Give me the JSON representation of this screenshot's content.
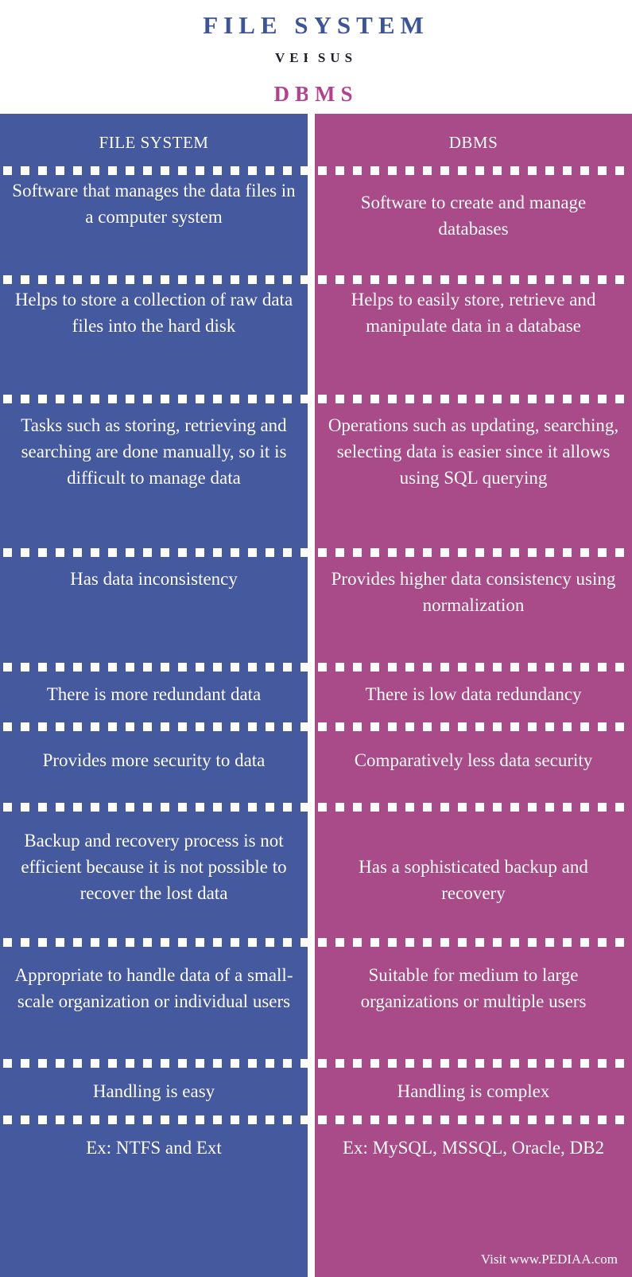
{
  "title": {
    "main": "FILE SYSTEM",
    "versus": "VERSUS",
    "sub": "DBMS"
  },
  "colors": {
    "left_panel": "#45599f",
    "right_panel": "#a94b88",
    "title_main": "#3c5499",
    "title_sub": "#b5418c",
    "versus": "#1f1f28",
    "text": "#ffffff",
    "background": "#ffffff"
  },
  "columns": {
    "left_header": "FILE SYSTEM",
    "right_header": "DBMS"
  },
  "rows": [
    {
      "left": "Software that manages the data files in a computer system",
      "right": "Software to create and manage databases"
    },
    {
      "left": "Helps to store a collection of raw data files into the hard disk",
      "right": "Helps to easily store, retrieve and manipulate data in a database"
    },
    {
      "left": "Tasks such as storing, retrieving and searching are done manually, so it is difficult to manage data",
      "right": "Operations such as updating, searching, selecting data is easier since it allows using SQL querying"
    },
    {
      "left": "Has data inconsistency",
      "right": "Provides higher data consistency using normalization"
    },
    {
      "left": "There is more redundant data",
      "right": "There is low data redundancy"
    },
    {
      "left": "Provides more security to data",
      "right": "Comparatively less data security"
    },
    {
      "left": "Backup and recovery process is not efficient because it is not possible to recover the lost data",
      "right": "Has a sophisticated backup and recovery"
    },
    {
      "left": "Appropriate to handle data of a small-scale organization or individual users",
      "right": "Suitable for medium to large organizations or multiple users"
    },
    {
      "left": "Handling is easy",
      "right": "Handling is complex"
    },
    {
      "left": "Ex: NTFS and Ext",
      "right": "Ex: MySQL, MSSQL, Oracle, DB2"
    }
  ],
  "footer": {
    "credit": "Visit www.PEDIAA.com"
  }
}
